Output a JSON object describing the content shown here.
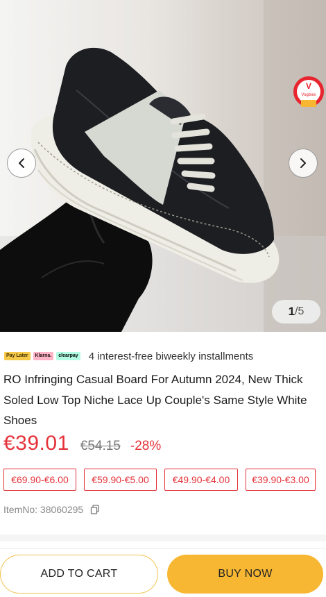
{
  "gallery": {
    "current": "1",
    "total_label": "/5",
    "badge_label": "Vogbiex"
  },
  "payment": {
    "providers": [
      "Pay Later",
      "Klarna.",
      "clearpay"
    ],
    "installment_text": "4 interest-free biweekly installments"
  },
  "product": {
    "title": "RO Infringing Casual Board For Autumn 2024, New Thick Soled Low Top Niche Lace Up Couple's Same Style White Shoes",
    "price_now": "€39.01",
    "price_old": "€54.15",
    "discount": "-28%",
    "tiers": [
      "€69.90-€6.00",
      "€59.90-€5.00",
      "€49.90-€4.00",
      "€39.90-€3.00"
    ],
    "item_no": "ItemNo: 38060295"
  },
  "actions": {
    "add_to_cart": "ADD TO CART",
    "buy_now": "BUY NOW"
  },
  "colors": {
    "accent_red": "#e5323a",
    "buy_yellow": "#f7b733"
  }
}
